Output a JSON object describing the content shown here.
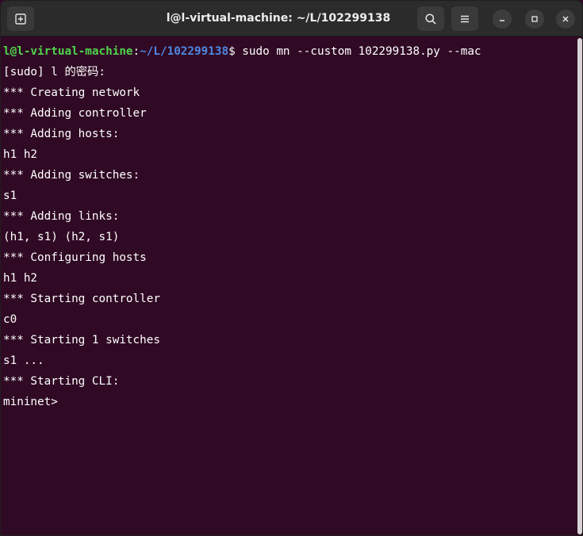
{
  "window": {
    "title": "l@l-virtual-machine: ~/L/102299138"
  },
  "icons": {
    "new_tab": "new-tab-icon",
    "search": "search-icon",
    "menu": "hamburger-menu-icon",
    "minimize": "minimize-icon",
    "maximize": "maximize-icon",
    "close": "close-icon"
  },
  "colors": {
    "terminal_bg": "#300a24",
    "prompt_user": "#4fd34d",
    "prompt_path": "#4f87e3",
    "text": "#ffffff"
  },
  "terminal": {
    "prompt": {
      "user_host": "l@l-virtual-machine",
      "sep": ":",
      "path": "~/L/102299138",
      "symbol": "$ ",
      "command": "sudo mn --custom 102299138.py --mac"
    },
    "lines": [
      "[sudo] l 的密码:",
      "*** Creating network",
      "*** Adding controller",
      "*** Adding hosts:",
      "h1 h2",
      "*** Adding switches:",
      "s1",
      "*** Adding links:",
      "(h1, s1) (h2, s1)",
      "*** Configuring hosts",
      "h1 h2",
      "*** Starting controller",
      "c0",
      "*** Starting 1 switches",
      "s1 ...",
      "*** Starting CLI:",
      "mininet>"
    ]
  }
}
